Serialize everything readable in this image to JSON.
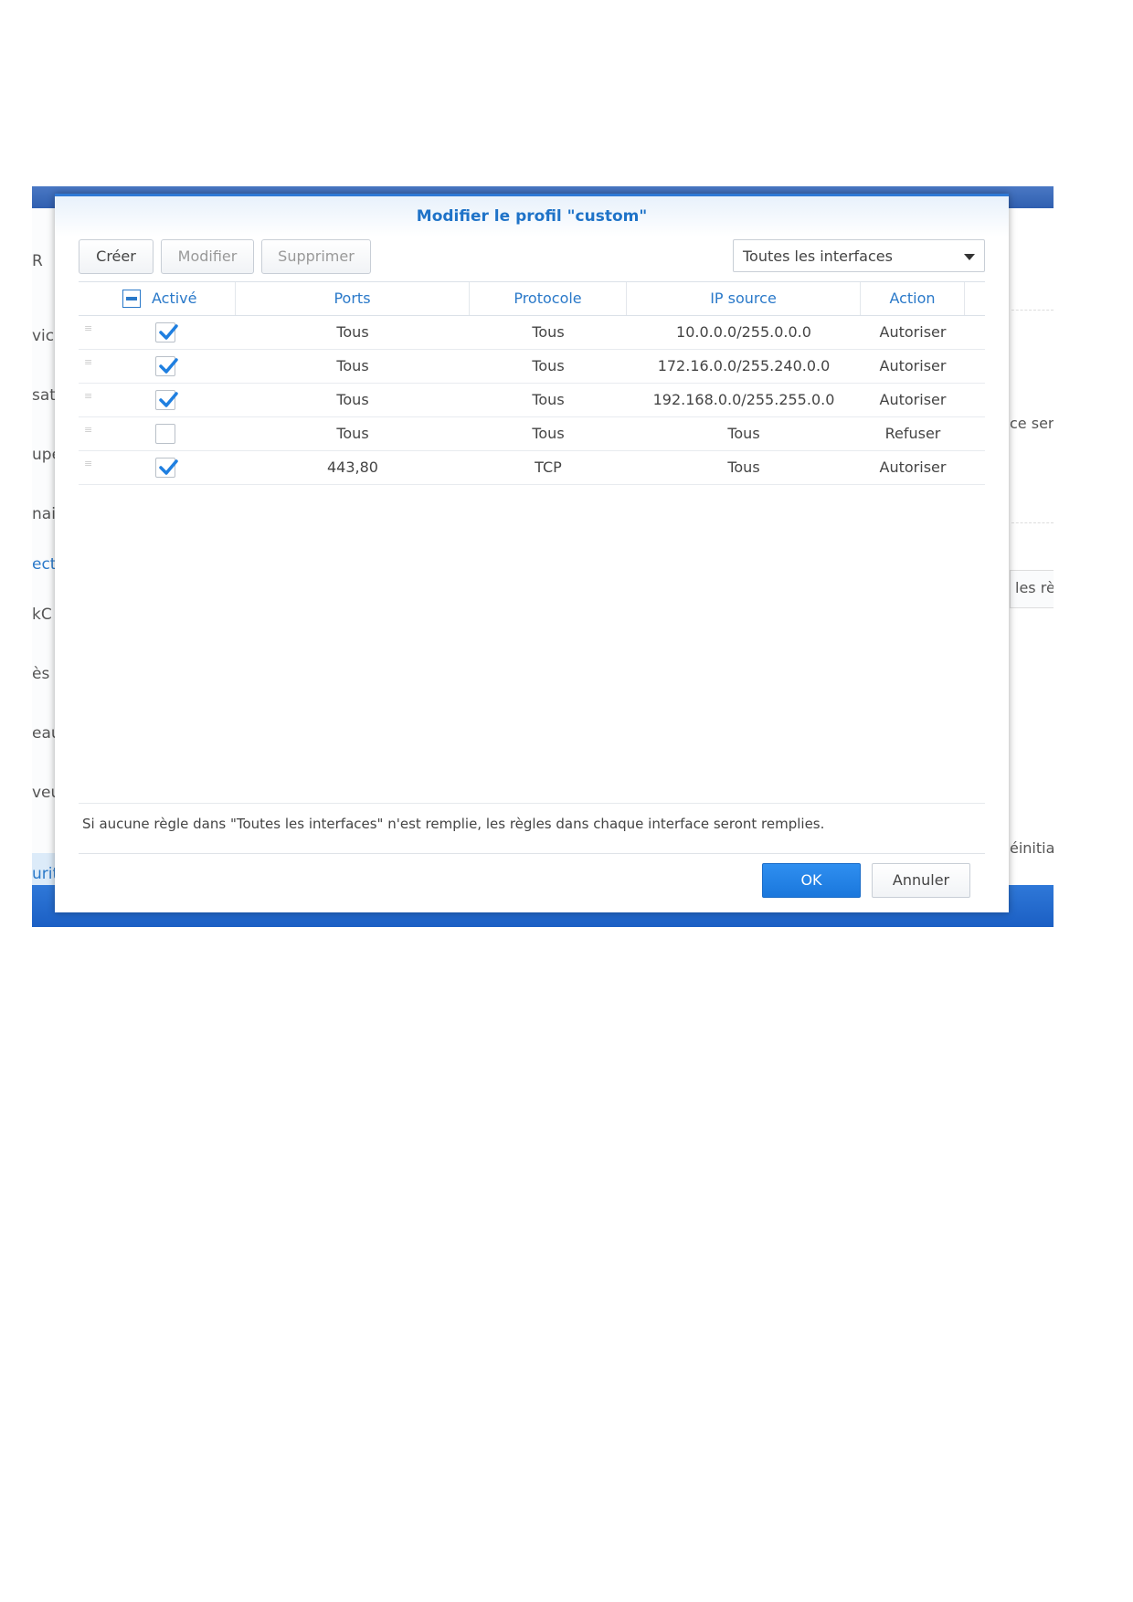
{
  "background": {
    "left_items": [
      " R",
      "vice",
      "sat",
      "upe",
      "nai",
      "ect",
      "kC",
      "ès",
      "eau",
      "veu",
      "urit"
    ],
    "right_texts": [
      "ce ser",
      "les rè",
      "éinitial"
    ]
  },
  "dialog": {
    "title": "Modifier le profil \"custom\"",
    "toolbar": {
      "create": "Créer",
      "edit": "Modifier",
      "delete": "Supprimer",
      "interface_select": "Toutes les interfaces"
    },
    "columns": [
      "Activé",
      "Ports",
      "Protocole",
      "IP source",
      "Action"
    ],
    "rows": [
      {
        "enabled": true,
        "ports": "Tous",
        "protocol": "Tous",
        "source": "10.0.0.0/255.0.0.0",
        "action": "Autoriser"
      },
      {
        "enabled": true,
        "ports": "Tous",
        "protocol": "Tous",
        "source": "172.16.0.0/255.240.0.0",
        "action": "Autoriser"
      },
      {
        "enabled": true,
        "ports": "Tous",
        "protocol": "Tous",
        "source": "192.168.0.0/255.255.0.0",
        "action": "Autoriser"
      },
      {
        "enabled": false,
        "ports": "Tous",
        "protocol": "Tous",
        "source": "Tous",
        "action": "Refuser"
      },
      {
        "enabled": true,
        "ports": "443,80",
        "protocol": "TCP",
        "source": "Tous",
        "action": "Autoriser"
      }
    ],
    "note": "Si aucune règle dans \"Toutes les interfaces\" n'est remplie, les règles dans chaque interface seront remplies.",
    "ok": "OK",
    "cancel": "Annuler"
  },
  "colors": {
    "accent": "#2a79c9",
    "primary_button": "#1a77dc",
    "check": "#1f7fe0"
  }
}
